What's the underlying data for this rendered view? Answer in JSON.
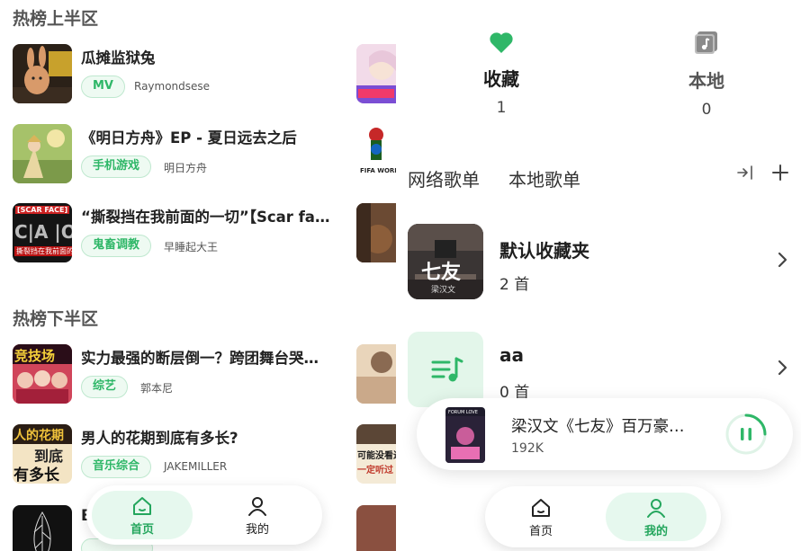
{
  "left": {
    "section_top": "热榜上半区",
    "section_bottom": "热榜下半区",
    "top_items": [
      {
        "title": "瓜摊监狱兔",
        "tag": "MV",
        "author": "Raymondsese"
      },
      {
        "title": "《明日方舟》EP - 夏日远去之后",
        "tag": "手机游戏",
        "author": "明日方舟"
      },
      {
        "title": "“撕裂挡在我前面的一切”【Scar face…",
        "tag": "鬼畜调教",
        "author": "早睡起大王"
      }
    ],
    "bottom_items": [
      {
        "title": "实力最强的断层倒一？跨团舞台哭…",
        "tag": "综艺",
        "author": "郭本尼"
      },
      {
        "title": "男人的花期到底有多长?",
        "tag": "音乐综合",
        "author": "JAKEMILLER"
      },
      {
        "title": "B",
        "tag": "",
        "author": ""
      }
    ],
    "thumb_texts": {
      "scar": "[SCAR FACE]",
      "scar_big": "C|A  |O",
      "scar_sub": "撕裂挡在我前面的…",
      "strong": "竞技场",
      "flower1": "人的花期",
      "flower2": "到底",
      "flower3": "有多长"
    },
    "peek_texts": {
      "fifa": "FIFA WORLD",
      "peek5_a": "可能没看过",
      "peek5_b": "一定听过"
    },
    "nav": {
      "home": "首页",
      "mine": "我的",
      "active": "home"
    }
  },
  "right": {
    "stats": [
      {
        "label": "收藏",
        "count": "1",
        "icon": "heart-icon"
      },
      {
        "label": "本地",
        "count": "0",
        "icon": "music-note-square-icon"
      }
    ],
    "tabs": [
      "网络歌单",
      "本地歌单"
    ],
    "playlists": [
      {
        "name": "默认收藏夹",
        "count": "2 首",
        "cover_text": "七友",
        "cover_sub": "梁汉文"
      },
      {
        "name": "aa",
        "count": "0 首",
        "icon": "playlist-music-icon"
      }
    ],
    "player": {
      "title": "梁汉文《七友》百万豪…",
      "subtitle": "192K",
      "cover_text": "FORUM LOVE"
    },
    "nav": {
      "home": "首页",
      "mine": "我的",
      "active": "mine"
    }
  },
  "colors": {
    "accent": "#2fb768",
    "accent_bg": "#e6f8ee"
  }
}
